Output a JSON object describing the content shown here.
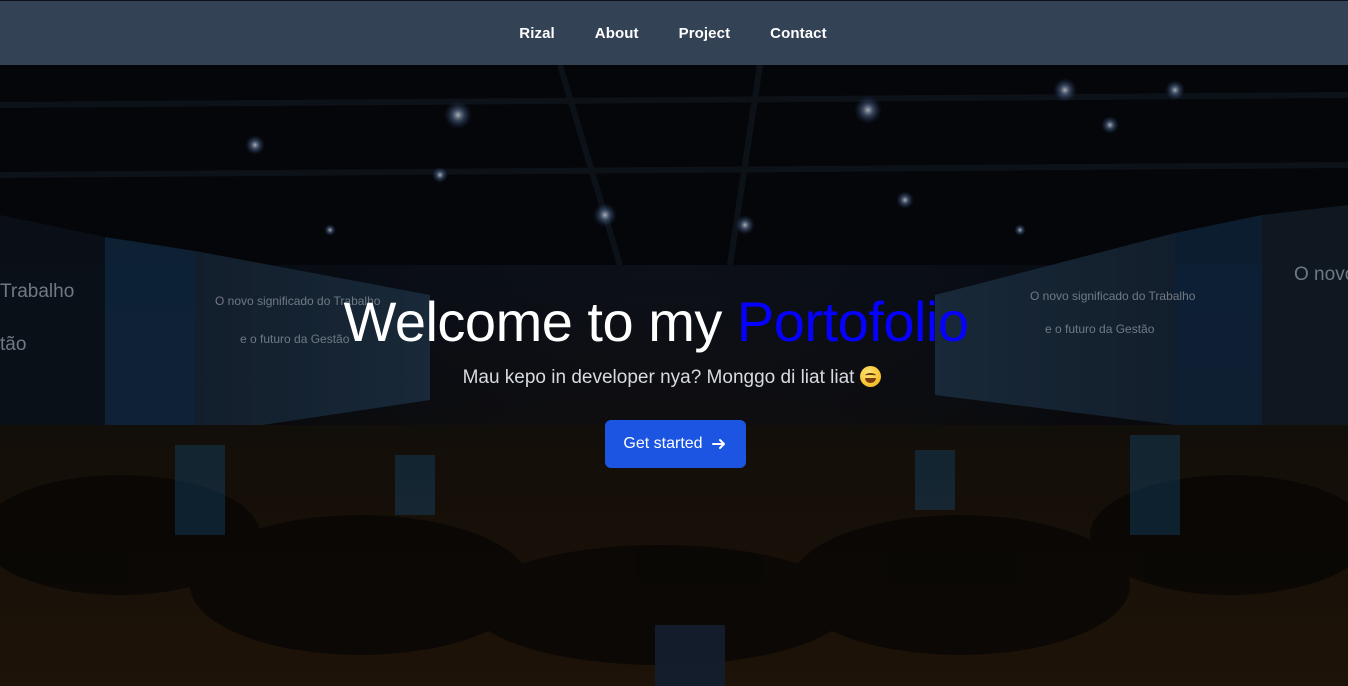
{
  "nav": {
    "items": [
      {
        "label": "Rizal"
      },
      {
        "label": "About"
      },
      {
        "label": "Project"
      },
      {
        "label": "Contact"
      }
    ]
  },
  "hero": {
    "title_main": "Welcome to my ",
    "title_accent": "Portofolio",
    "subtitle": "Mau kepo in developer nya? Monggo di liat liat",
    "subtitle_emoji": "grinning-sweat-emoji",
    "background_image": "conference-audience-photo",
    "screen_text_left_1": "O novo significado do Trabalho",
    "screen_text_left_2": "e o futuro da Gestão",
    "screen_text_left_edge_1": "Trabalho",
    "screen_text_left_edge_2": "tão",
    "screen_text_right_1": "O novo significado do Trabalho",
    "screen_text_right_2": "e o futuro da Gestão",
    "screen_text_right_edge": "O novo",
    "cta": {
      "label": "Get started",
      "icon": "arrow-right-icon"
    }
  },
  "colors": {
    "navbar_bg": "#344256",
    "accent": "#0500ff",
    "button_bg": "#1b55e2"
  }
}
